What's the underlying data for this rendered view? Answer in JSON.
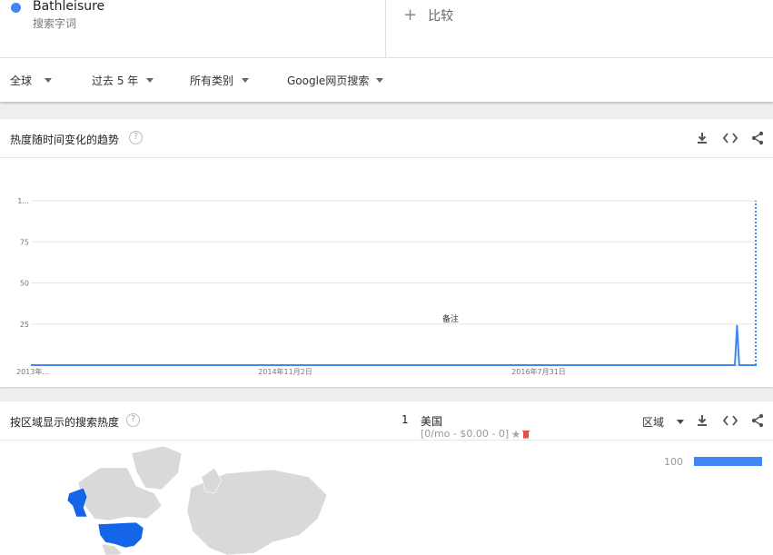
{
  "term": {
    "name": "Bathleisure",
    "type": "搜索字词",
    "color": "#4285f4"
  },
  "compare": {
    "plus": "+",
    "label": "比较"
  },
  "filters": [
    {
      "label": "全球"
    },
    {
      "label": "过去 5 年"
    },
    {
      "label": "所有类别"
    },
    {
      "label": "Google网页搜索"
    }
  ],
  "interest_over_time": {
    "title": "热度随时间变化的趋势",
    "help": "?",
    "note_label": "备注"
  },
  "chart_data": {
    "type": "line",
    "y_ticks": [
      "1...",
      "75",
      "50",
      "25"
    ],
    "x_ticks": [
      "2013年...",
      "2014年11月2日",
      "2016年7月31日"
    ],
    "ylim": [
      0,
      100
    ],
    "series": [
      {
        "color": "#4285f4",
        "values_description": "flat at 0 until a spike near the end",
        "points": [
          {
            "x": 0,
            "y": 0
          },
          {
            "x": 0.97,
            "y": 0
          },
          {
            "x": 0.973,
            "y": 24
          },
          {
            "x": 0.976,
            "y": 0
          },
          {
            "x": 1.0,
            "y": 0
          }
        ],
        "partial_point": {
          "x": 1.0,
          "y": 100
        }
      }
    ]
  },
  "interest_by_region": {
    "title": "按区域显示的搜索热度",
    "help": "?",
    "resolution": "区域",
    "rows": [
      {
        "rank": "1",
        "name": "美国",
        "sub": "[0/mo - $0.00 - 0]",
        "value": "100",
        "fraction": 1.0
      }
    ]
  },
  "colors": {
    "accent": "#4285f4",
    "map_highlight": "#1565e8",
    "map_land": "#d9d9d9"
  }
}
